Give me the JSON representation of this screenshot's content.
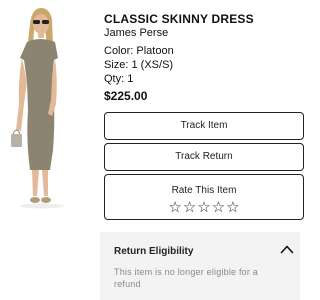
{
  "product": {
    "name": "CLASSIC SKINNY DRESS",
    "brand": "James Perse",
    "color": "Color: Platoon",
    "size": "Size: 1 (XS/S)",
    "qty": "Qty: 1",
    "price": "$225.00",
    "image_icon": "dress-photo"
  },
  "actions": {
    "track_item": "Track Item",
    "track_return": "Track Return"
  },
  "rating": {
    "label": "Rate This Item",
    "stars": [
      "☆",
      "☆",
      "☆",
      "☆",
      "☆"
    ],
    "max": 5,
    "value": 0
  },
  "return_eligibility": {
    "title": "Return Eligibility",
    "message": "This item is no longer eligible for a refund",
    "expanded": true,
    "icon": "chevron-up-icon"
  },
  "colors": {
    "panel_bg": "#f3f3f3",
    "dress": "#8b8470",
    "muted_text": "#8a8a8a"
  }
}
